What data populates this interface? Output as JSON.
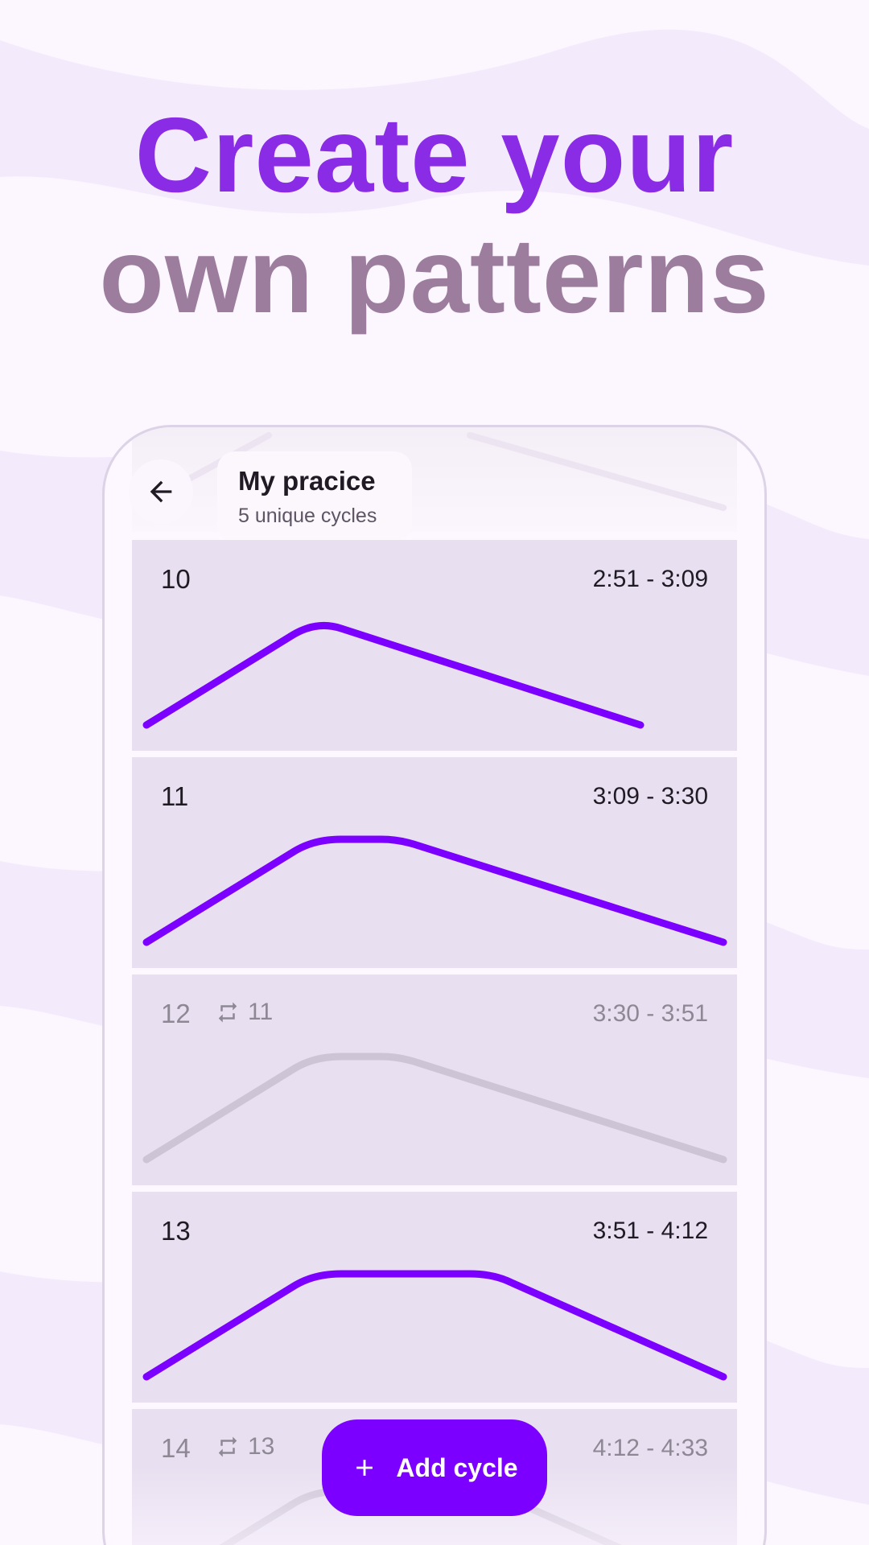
{
  "headline": {
    "line1": "Create your",
    "line2": "own patterns"
  },
  "screen": {
    "title": "My pracice",
    "subtitle": "5 unique cycles",
    "back_icon": "arrow-back-icon"
  },
  "cycles": [
    {
      "number": "10",
      "time": "2:51 - 3:09",
      "repeat_of": ""
    },
    {
      "number": "11",
      "time": "3:09 - 3:30",
      "repeat_of": ""
    },
    {
      "number": "12",
      "time": "3:30 - 3:51",
      "repeat_of": "11"
    },
    {
      "number": "13",
      "time": "3:51 - 4:12",
      "repeat_of": ""
    },
    {
      "number": "14",
      "time": "4:12 - 4:33",
      "repeat_of": "13"
    }
  ],
  "add_button": {
    "label": "Add cycle",
    "icon": "plus-icon"
  },
  "colors": {
    "accent": "#7c00ff",
    "headline_purple": "#8a2be6",
    "headline_mauve": "#9d7d9e",
    "card_bg": "#e8dff0",
    "repeat_line": "#cdc4d6"
  }
}
